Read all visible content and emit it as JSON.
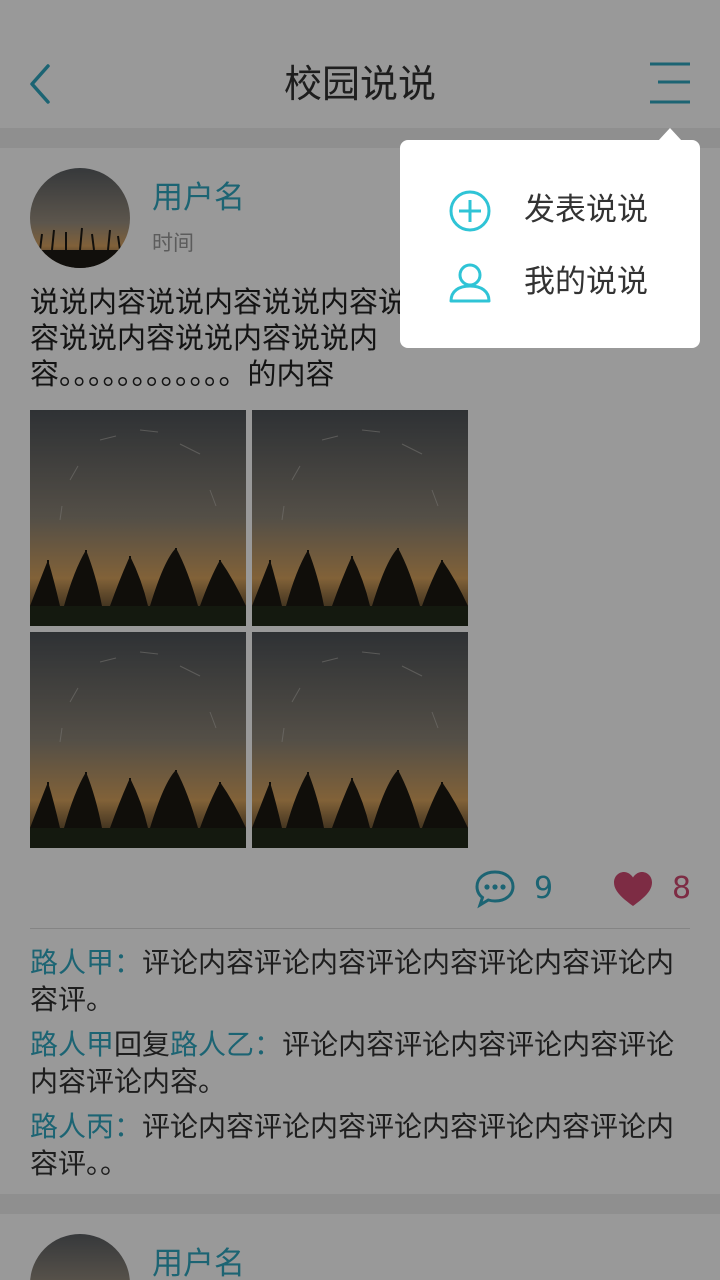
{
  "header": {
    "title": "校园说说"
  },
  "menu": {
    "items": [
      {
        "label": "发表说说",
        "icon": "plus-circle-icon"
      },
      {
        "label": "我的说说",
        "icon": "user-icon"
      }
    ]
  },
  "post": {
    "username": "用户名",
    "time": "时间",
    "content": "说说内容说说内容说说内容说说内容说说内容说说内容说说内容说说内容。。。。。。。。。。。。的内容",
    "comment_count": "9",
    "like_count": "8",
    "comments": [
      {
        "name": "路人甲",
        "sep": "：",
        "text": "评论内容评论内容评论内容评论内容评论内容评。"
      },
      {
        "name": "路人甲",
        "reply_word": "回复",
        "target": "路人乙",
        "sep": "：",
        "text": "评论内容评论内容评论内容评论内容评论内容。"
      },
      {
        "name": "路人丙",
        "sep": "：",
        "text": "评论内容评论内容评论内容评论内容评论内容评。。"
      }
    ]
  },
  "post2": {
    "username": "用户名"
  },
  "colors": {
    "accent": "#2fa7c0",
    "like": "#d04a72",
    "overlay": "rgba(0,0,0,0.40)"
  }
}
